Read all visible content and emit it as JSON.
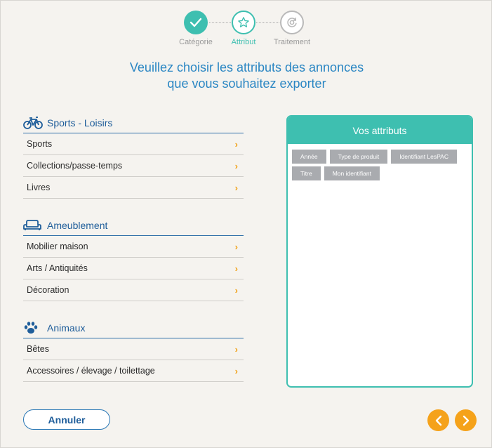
{
  "stepper": {
    "steps": [
      {
        "label": "Catégorie",
        "state": "done",
        "icon": "check-icon"
      },
      {
        "label": "Attribut",
        "state": "active",
        "icon": "star-icon"
      },
      {
        "label": "Traitement",
        "state": "todo",
        "icon": "process-icon"
      }
    ]
  },
  "title": {
    "line1": "Veuillez choisir les attributs des annonces",
    "line2": "que vous souhaitez exporter"
  },
  "categories": [
    {
      "name": "Sports - Loisirs",
      "icon": "bicycle-icon",
      "items": [
        "Sports",
        "Collections/passe-temps",
        "Livres"
      ]
    },
    {
      "name": "Ameublement",
      "icon": "sofa-icon",
      "items": [
        "Mobilier maison",
        "Arts / Antiquités",
        "Décoration"
      ]
    },
    {
      "name": "Animaux",
      "icon": "paw-icon",
      "items": [
        "Bêtes",
        "Accessoires / élevage / toilettage"
      ]
    }
  ],
  "attributes_panel": {
    "title": "Vos attributs",
    "tags": [
      "Année",
      "Type de produit",
      "Identifiant LesPAC",
      "Titre",
      "Mon identifiant"
    ]
  },
  "footer": {
    "cancel_label": "Annuler",
    "prev_icon": "chevron-left-icon",
    "next_icon": "chevron-right-icon"
  },
  "colors": {
    "teal": "#3ebfb0",
    "blue": "#1e5d9a",
    "orange": "#f5a21a",
    "tag_gray": "#a9abaf"
  }
}
